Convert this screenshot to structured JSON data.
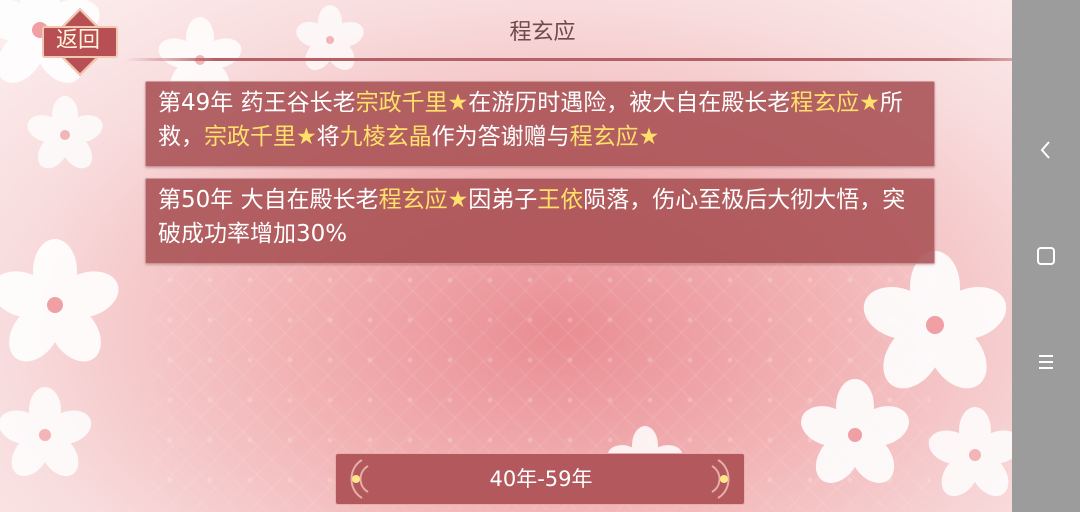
{
  "header": {
    "title": "程玄应",
    "back_label": "返回"
  },
  "events": [
    {
      "segments": [
        {
          "text": "第49年 药王谷长老",
          "hl": false
        },
        {
          "text": "宗政千里★",
          "hl": true
        },
        {
          "text": "在游历时遇险，被大自在殿长老",
          "hl": false
        },
        {
          "text": "程玄应★",
          "hl": true
        },
        {
          "text": "所救，",
          "hl": false
        },
        {
          "text": "宗政千里★",
          "hl": true
        },
        {
          "text": "将",
          "hl": false
        },
        {
          "text": "九棱玄晶",
          "hl": true
        },
        {
          "text": "作为答谢赠与",
          "hl": false
        },
        {
          "text": "程玄应★",
          "hl": true
        }
      ]
    },
    {
      "segments": [
        {
          "text": "第50年 大自在殿长老",
          "hl": false
        },
        {
          "text": "程玄应★",
          "hl": true
        },
        {
          "text": "因弟子",
          "hl": false
        },
        {
          "text": "王依",
          "hl": true
        },
        {
          "text": "陨落，伤心至极后大彻大悟，突破成功率增加30%",
          "hl": false
        }
      ]
    }
  ],
  "pager": {
    "label": "40年-59年"
  },
  "colors": {
    "highlight": "#ffe06a",
    "card_bg": "#a64c50",
    "sidebar": "#9c9c9c"
  },
  "system_nav": [
    "back-icon",
    "home-icon",
    "menu-icon"
  ]
}
